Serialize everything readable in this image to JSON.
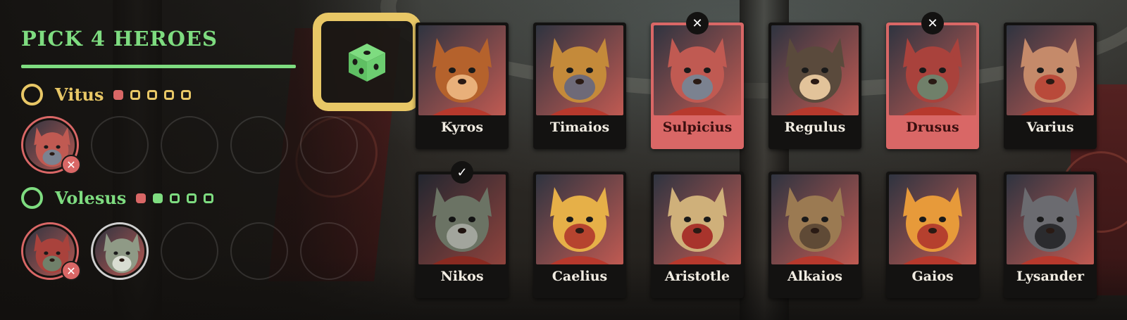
{
  "panel": {
    "title": "PICK 4 HEROES"
  },
  "players": [
    {
      "name": "Vitus",
      "color": "#e8c766",
      "pips": [
        "filled-red",
        "hollow",
        "hollow",
        "hollow",
        "hollow"
      ],
      "slots": [
        {
          "hero": "Sulpicius",
          "removable": true,
          "remove_symbol": "✕"
        },
        {
          "hero": null
        },
        {
          "hero": null
        },
        {
          "hero": null
        },
        {
          "hero": null
        }
      ]
    },
    {
      "name": "Volesus",
      "color": "#7edc80",
      "pips": [
        "filled-red",
        "filled-green",
        "hollow",
        "hollow",
        "hollow"
      ],
      "slots": [
        {
          "hero": "Drusus",
          "removable": true,
          "remove_symbol": "✕"
        },
        {
          "hero": "Nikos",
          "removable": false
        },
        {
          "hero": null
        },
        {
          "hero": null
        },
        {
          "hero": null
        }
      ]
    }
  ],
  "dice_button": {
    "icon": "dice-icon",
    "color": "#7edc80"
  },
  "heroes": [
    {
      "name": "Kyros",
      "state": "available",
      "palette": [
        "#b5622c",
        "#4a2a1c",
        "#e9b07a"
      ]
    },
    {
      "name": "Timaios",
      "state": "available",
      "palette": [
        "#c48a3a",
        "#3b3a45",
        "#6e6a78"
      ]
    },
    {
      "name": "Sulpicius",
      "state": "banned",
      "badge": "✕",
      "palette": [
        "#c05a52",
        "#2f3440",
        "#7b8290"
      ]
    },
    {
      "name": "Regulus",
      "state": "available",
      "palette": [
        "#5a4a3c",
        "#b98a5a",
        "#e2c39a"
      ]
    },
    {
      "name": "Drusus",
      "state": "banned",
      "badge": "✕",
      "palette": [
        "#a9423c",
        "#3b3a36",
        "#70806a"
      ]
    },
    {
      "name": "Varius",
      "state": "available",
      "palette": [
        "#c58a6a",
        "#f2efe9",
        "#b94a3a"
      ]
    },
    {
      "name": "Nikos",
      "state": "picked",
      "badge": "✓",
      "palette": [
        "#8f9a86",
        "#4a4f52",
        "#d9ddd2"
      ]
    },
    {
      "name": "Caelius",
      "state": "available",
      "palette": [
        "#e6b048",
        "#f5ecd8",
        "#b6442f"
      ]
    },
    {
      "name": "Aristotle",
      "state": "available",
      "palette": [
        "#cfb07a",
        "#f3ead6",
        "#a8342c"
      ]
    },
    {
      "name": "Alkaios",
      "state": "available",
      "palette": [
        "#9b7a52",
        "#e9dcc1",
        "#5f4a36"
      ]
    },
    {
      "name": "Gaios",
      "state": "available",
      "palette": [
        "#e79a3a",
        "#fbf3e3",
        "#b5402e"
      ]
    },
    {
      "name": "Lysander",
      "state": "available",
      "palette": [
        "#6b6b70",
        "#efefef",
        "#2b2b2e"
      ]
    }
  ],
  "colors": {
    "accent_green": "#7edc80",
    "accent_gold": "#e8c766",
    "ban_red": "#d96766",
    "card_bg": "#131211"
  }
}
